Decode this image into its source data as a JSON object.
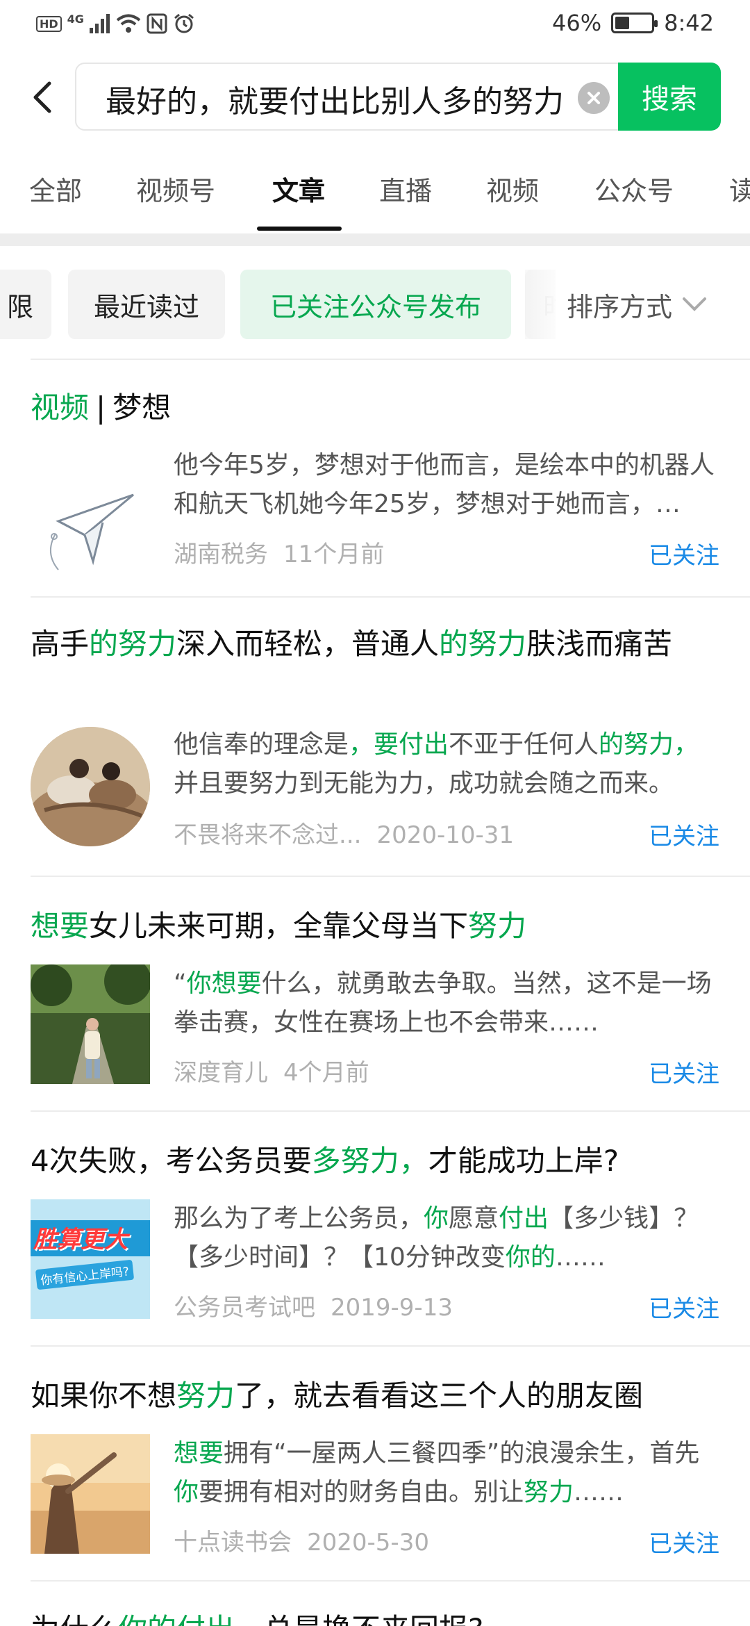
{
  "status_bar": {
    "left_labels": [
      "HD",
      "4G"
    ],
    "battery_percent": "46%",
    "battery_level": 0.46,
    "time": "8:42"
  },
  "search": {
    "query_visible": "最好的，就要付出比别人多的努力",
    "button_label": "搜索"
  },
  "tabs": [
    "全部",
    "视频号",
    "文章",
    "直播",
    "视频",
    "公众号",
    "读"
  ],
  "active_tab_index": 2,
  "filters": {
    "chips": [
      "限",
      "最近读过",
      "已关注公众号发布",
      "时"
    ],
    "active_chip_index": 2,
    "sort_label": "排序方式"
  },
  "colors": {
    "accent": "#07c160",
    "highlight": "#07a74f",
    "follow": "#1a8ae6"
  },
  "articles": [
    {
      "title_parts": [
        {
          "text": "视频",
          "hl": true
        },
        {
          "text": "|",
          "sep": true
        },
        {
          "text": "梦想",
          "hl": false
        }
      ],
      "thumb": "paper-plane-icon",
      "snippet_parts": [
        {
          "text": "他今年5岁，梦想对于他而言，是绘本中的机器人和航天飞机她今年25岁，梦想对于她而言，是……",
          "hl": false
        }
      ],
      "source": "湖南税务",
      "time": "11个月前",
      "follow": "已关注"
    },
    {
      "title_parts": [
        {
          "text": "高手",
          "hl": false
        },
        {
          "text": "的努力",
          "hl": true
        },
        {
          "text": "深入而轻松，普通人",
          "hl": false
        },
        {
          "text": "的努力",
          "hl": true
        },
        {
          "text": "肤浅而痛苦",
          "hl": false
        }
      ],
      "thumb": "couple-photo",
      "snippet_parts": [
        {
          "text": "他信奉的理念是",
          "hl": false
        },
        {
          "text": "，要付出",
          "hl": true
        },
        {
          "text": "不亚于任何人",
          "hl": false
        },
        {
          "text": "的努力，",
          "hl": true
        },
        {
          "text": "并且要努力到无能为力，成功就会随之而来。",
          "hl": false
        }
      ],
      "source": "不畏将来不念过...",
      "time": "2020-10-31",
      "follow": "已关注"
    },
    {
      "title_parts": [
        {
          "text": "想要",
          "hl": true
        },
        {
          "text": "女儿未来可期，全靠父母当下",
          "hl": false
        },
        {
          "text": "努力",
          "hl": true
        }
      ],
      "thumb": "girl-forest-photo",
      "snippet_parts": [
        {
          "text": "“",
          "hl": false
        },
        {
          "text": "你想要",
          "hl": true
        },
        {
          "text": "什么，就勇敢去争取。当然，这不是一场拳击赛，女性在赛场上也不会带来……",
          "hl": false
        }
      ],
      "source": "深度育儿",
      "time": "4个月前",
      "follow": "已关注"
    },
    {
      "title_parts": [
        {
          "text": "4次失败，考公务员要",
          "hl": false
        },
        {
          "text": "多努力，",
          "hl": true
        },
        {
          "text": "才能成功上岸?",
          "hl": false
        }
      ],
      "thumb": "exam-banner",
      "thumb_text": [
        "胜算更大",
        "你有信心上岸吗?"
      ],
      "snippet_parts": [
        {
          "text": "那么为了考上公务员，",
          "hl": false
        },
        {
          "text": "你",
          "hl": true
        },
        {
          "text": "愿意",
          "hl": false
        },
        {
          "text": "付出",
          "hl": true
        },
        {
          "text": "【多少钱】？【多少时间】？【10分钟改变",
          "hl": false
        },
        {
          "text": "你的",
          "hl": true
        },
        {
          "text": "……",
          "hl": false
        }
      ],
      "source": "公务员考试吧",
      "time": "2019-9-13",
      "follow": "已关注"
    },
    {
      "title_parts": [
        {
          "text": "如果你不想",
          "hl": false
        },
        {
          "text": "努力",
          "hl": true
        },
        {
          "text": "了，就去看看这三个人的朋友圈",
          "hl": false
        }
      ],
      "thumb": "woman-sunset-photo",
      "snippet_parts": [
        {
          "text": "想要",
          "hl": true
        },
        {
          "text": "拥有“一屋两人三餐四季”的浪漫余生，首先",
          "hl": false
        },
        {
          "text": "你",
          "hl": true
        },
        {
          "text": "要拥有相对的财务自由。别让",
          "hl": false
        },
        {
          "text": "努力",
          "hl": true
        },
        {
          "text": "……",
          "hl": false
        }
      ],
      "source": "十点读书会",
      "time": "2020-5-30",
      "follow": "已关注"
    },
    {
      "title_parts": [
        {
          "text": "为什么",
          "hl": false
        },
        {
          "text": "你的付出",
          "hl": true
        },
        {
          "text": "，总是换不来回报?",
          "hl": false
        }
      ]
    }
  ]
}
